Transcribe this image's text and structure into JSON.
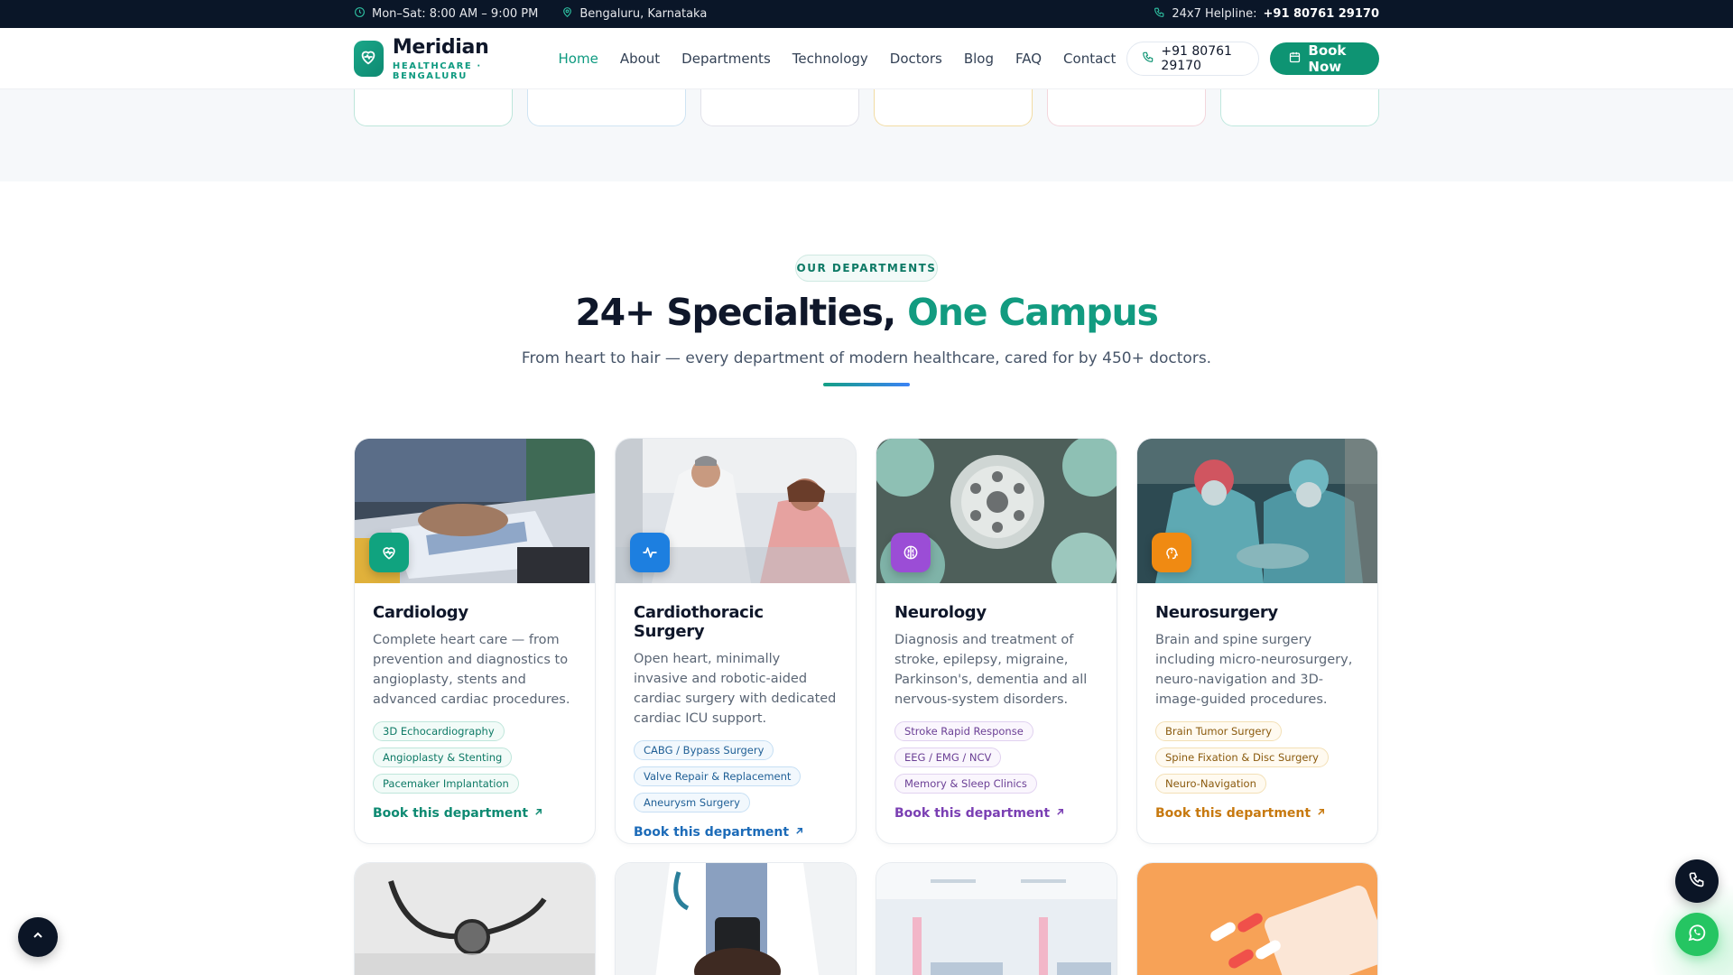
{
  "topbar": {
    "hours": "Mon–Sat: 8:00 AM – 9:00 PM",
    "location": "Bengaluru, Karnataka",
    "helpline_label": "24x7 Helpline:",
    "helpline_number": "+91 80761 29170"
  },
  "header": {
    "brand_name": "Meridian",
    "brand_sub": "HEALTHCARE · BENGALURU",
    "nav": [
      {
        "label": "Home",
        "active": true
      },
      {
        "label": "About"
      },
      {
        "label": "Departments"
      },
      {
        "label": "Technology"
      },
      {
        "label": "Doctors"
      },
      {
        "label": "Blog"
      },
      {
        "label": "FAQ"
      },
      {
        "label": "Contact"
      }
    ],
    "phone": "+91 80761 29170",
    "book_label": "Book Now"
  },
  "departments": {
    "eyebrow": "OUR DEPARTMENTS",
    "title_main": "24+ Specialties,",
    "title_highlight": "One Campus",
    "subtitle": "From heart to hair — every department of modern healthcare, cared for by 450+ doctors.",
    "cards": [
      {
        "title": "Cardiology",
        "description": "Complete heart care — from prevention and diagnostics to angioplasty, stents and advanced cardiac procedures.",
        "tags": [
          "3D Echocardiography",
          "Angioplasty & Stenting",
          "Pacemaker Implantation"
        ],
        "link": "Book this department",
        "icon": "heart-pulse-icon",
        "accent": "#10a37f"
      },
      {
        "title": "Cardiothoracic Surgery",
        "description": "Open heart, minimally invasive and robotic-aided cardiac surgery with dedicated cardiac ICU support.",
        "tags": [
          "CABG / Bypass Surgery",
          "Valve Repair & Replacement",
          "Aneurysm Surgery"
        ],
        "link": "Book this department",
        "icon": "activity-icon",
        "accent": "#1d7fe0"
      },
      {
        "title": "Neurology",
        "description": "Diagnosis and treatment of stroke, epilepsy, migraine, Parkinson's, dementia and all nervous-system disorders.",
        "tags": [
          "Stroke Rapid Response",
          "EEG / EMG / NCV",
          "Memory & Sleep Clinics"
        ],
        "link": "Book this department",
        "icon": "brain-icon",
        "accent": "#9b4dd6"
      },
      {
        "title": "Neurosurgery",
        "description": "Brain and spine surgery including micro-neurosurgery, neuro-navigation and 3D-image-guided procedures.",
        "tags": [
          "Brain Tumor Surgery",
          "Spine Fixation & Disc Surgery",
          "Neuro-Navigation"
        ],
        "link": "Book this department",
        "icon": "head-brain-icon",
        "accent": "#f08a12"
      }
    ]
  },
  "colors": {
    "primary": "#0e9473",
    "topbar_bg": "#0a1628",
    "whatsapp": "#25c562"
  }
}
